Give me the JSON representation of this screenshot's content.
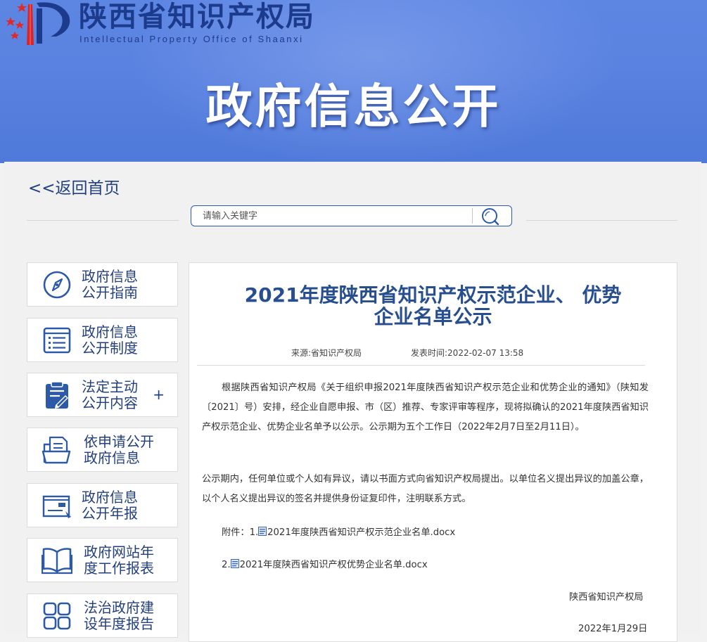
{
  "header": {
    "org_name_cn": "陕西省知识产权局",
    "org_name_en": "Intellectual Property Office of Shaanxi",
    "banner_title": "政府信息公开"
  },
  "nav": {
    "back_label": "<<返回首页"
  },
  "search": {
    "placeholder": "请输入关键字",
    "value": ""
  },
  "sidebar": {
    "items": [
      {
        "label": "政府信息\n公开指南",
        "icon": "compass-icon"
      },
      {
        "label": "政府信息\n公开制度",
        "icon": "list-icon"
      },
      {
        "label": "法定主动\n公开内容",
        "icon": "clipboard-edit-icon",
        "expand": "+"
      },
      {
        "label": "依申请公开\n政府信息",
        "icon": "folder-document-icon"
      },
      {
        "label": "政府信息\n公开年报",
        "icon": "report-window-icon"
      },
      {
        "label": "政府网站年\n度工作报表",
        "icon": "open-book-icon"
      },
      {
        "label": "法治政府建\n设年度报告",
        "icon": "grid-icon"
      }
    ]
  },
  "article": {
    "title_line1": "2021年度陕西省知识产权示范企业、 优势",
    "title_line2": "企业名单公示",
    "source_label": "来源:",
    "source": "省知识产权局",
    "published_label": "发表时间:",
    "published": "2022-02-07 13:58",
    "paragraph1": "根据陕西省知识产权局《关于组织申报2021年度陕西省知识产权示范企业和优势企业的通知》（陕知发〔2021〕号）安排，经企业自愿申报、市（区）推荐、专家评审等程序，现将拟确认的2021年度陕西省知识产权示范企业、优势企业名单予以公示。公示期为五个工作日（2022年2月7日至2月11日）。",
    "paragraph2": "公示期内，任何单位或个人如有异议，请以书面方式向省知识产权局提出。以单位名义提出异议的加盖公章，以个人名义提出异议的签名并提供身份证复印件，注明联系方式。",
    "attachments_label": "附件：",
    "attachments": [
      {
        "index": "1.",
        "name": "2021年度陕西省知识产权示范企业名单.docx"
      },
      {
        "index": "2.",
        "name": "2021年度陕西省知识产权优势企业名单.docx"
      }
    ],
    "signature": "陕西省知识产权局",
    "date": "2022年1月29日"
  },
  "colors": {
    "banner": "#5a82e0",
    "brand_dark": "#1d3b8c",
    "title_blue": "#274f8f",
    "emblem_red": "#e02a2a"
  }
}
